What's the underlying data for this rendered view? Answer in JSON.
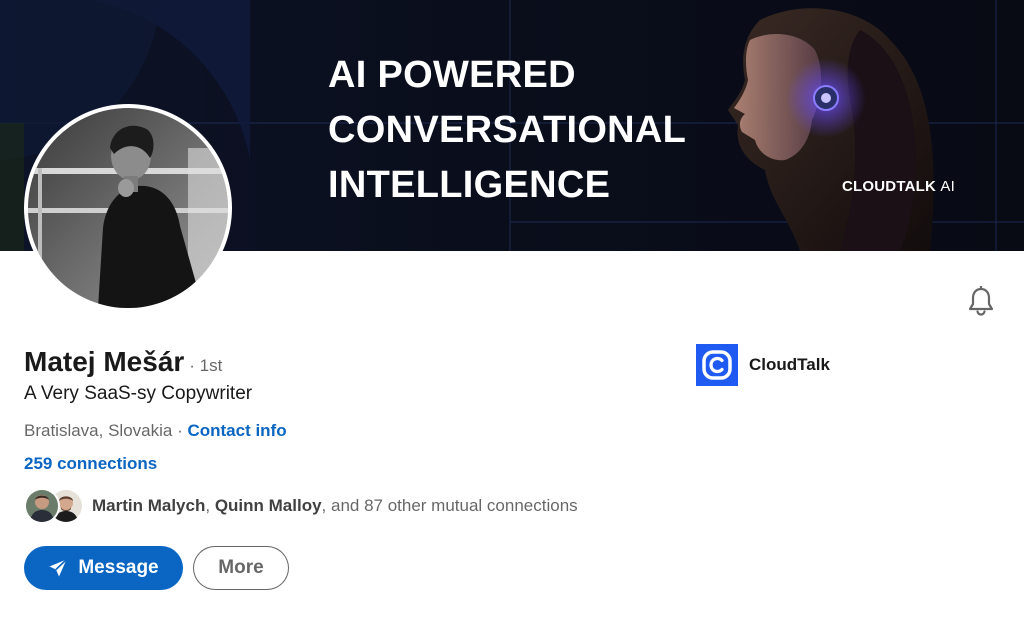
{
  "banner": {
    "headline_lines": [
      "AI POWERED",
      "CONVERSATIONAL",
      "INTELLIGENCE"
    ],
    "brand_name": "CLOUDTALK",
    "brand_suffix": "AI"
  },
  "profile": {
    "name": "Matej Mešár",
    "degree": "· 1st",
    "headline": "A Very SaaS-sy Copywriter",
    "location": "Bratislava, Slovakia",
    "location_separator": " · ",
    "contact_info_label": "Contact info",
    "connections_label": "259 connections"
  },
  "mutual": {
    "name_1": "Martin Malych",
    "separator": ", ",
    "name_2": "Quinn Malloy",
    "suffix": ", and 87 other mutual connections"
  },
  "actions": {
    "message_label": "Message",
    "more_label": "More"
  },
  "company": {
    "name": "CloudTalk"
  },
  "icons": {
    "notification": "bell-icon",
    "message": "send-icon",
    "company_logo": "cloudtalk-logo-icon"
  },
  "colors": {
    "link_blue": "#0a66c2",
    "banner_background": "#0a0e1c",
    "company_logo_blue": "#1f5bf2",
    "banner_accent_purple": "#6a4cff"
  }
}
